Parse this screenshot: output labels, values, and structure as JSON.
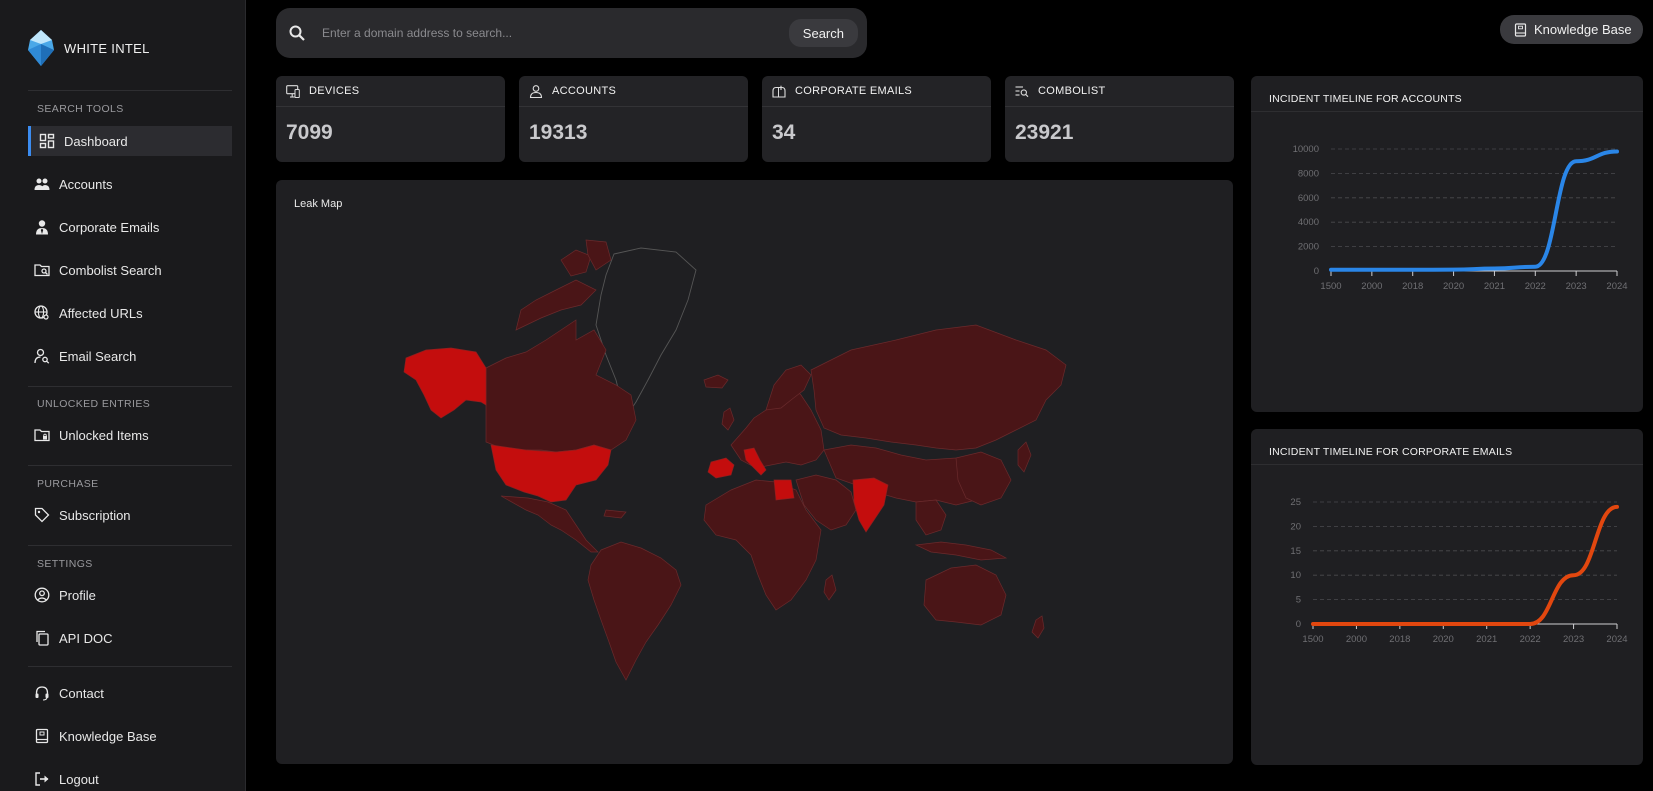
{
  "brand": {
    "name": "WHITE INTEL"
  },
  "sidebar": {
    "sections": {
      "search_tools": "SEARCH TOOLS",
      "unlocked_entries": "UNLOCKED ENTRIES",
      "purchase": "PURCHASE",
      "settings": "SETTINGS"
    },
    "items": {
      "dashboard": "Dashboard",
      "accounts": "Accounts",
      "corporate_emails": "Corporate Emails",
      "combolist_search": "Combolist Search",
      "affected_urls": "Affected URLs",
      "email_search": "Email Search",
      "unlocked_items": "Unlocked Items",
      "subscription": "Subscription",
      "profile": "Profile",
      "api_doc": "API DOC",
      "contact": "Contact",
      "knowledge_base": "Knowledge Base",
      "logout": "Logout"
    },
    "active_item": "dashboard"
  },
  "search": {
    "placeholder": "Enter a domain address to search...",
    "value": "",
    "button_label": "Search"
  },
  "header": {
    "knowledge_base_label": "Knowledge Base"
  },
  "stats": {
    "devices": {
      "label": "DEVICES",
      "value": "7099"
    },
    "accounts": {
      "label": "ACCOUNTS",
      "value": "19313"
    },
    "corporate_emails": {
      "label": "CORPORATE EMAILS",
      "value": "34"
    },
    "combolist": {
      "label": "COMBOLIST",
      "value": "23921"
    }
  },
  "leak_map": {
    "title": "Leak Map",
    "base_color": "#4a1517",
    "highlight_color": "#c40d0d",
    "highlighted_regions": [
      "Alaska",
      "United States",
      "Spain",
      "Italy",
      "Egypt",
      "India"
    ]
  },
  "colors": {
    "accent": "#3b8cf0",
    "accounts_line": "#2a86e8",
    "emails_line": "#e2470f",
    "background": "#000000",
    "panel": "#1f1f22"
  },
  "chart_data": [
    {
      "type": "line",
      "title": "INCIDENT TIMELINE FOR ACCOUNTS",
      "x": [
        "1500",
        "2000",
        "2018",
        "2020",
        "2021",
        "2022",
        "2023",
        "2024"
      ],
      "series": [
        {
          "values": [
            100,
            100,
            100,
            110,
            200,
            350,
            9000,
            9800
          ]
        }
      ],
      "ylim": [
        0,
        10000
      ],
      "yticks": [
        0,
        2000,
        4000,
        6000,
        8000,
        10000
      ],
      "grid": true,
      "color": "#2a86e8"
    },
    {
      "type": "line",
      "title": "INCIDENT TIMELINE FOR CORPORATE EMAILS",
      "x": [
        "1500",
        "2000",
        "2018",
        "2020",
        "2021",
        "2022",
        "2023",
        "2024"
      ],
      "series": [
        {
          "values": [
            0,
            0,
            0,
            0,
            0,
            0,
            10,
            24
          ]
        }
      ],
      "ylim": [
        0,
        25
      ],
      "yticks": [
        0,
        5,
        10,
        15,
        20,
        25
      ],
      "grid": true,
      "color": "#e2470f"
    }
  ]
}
